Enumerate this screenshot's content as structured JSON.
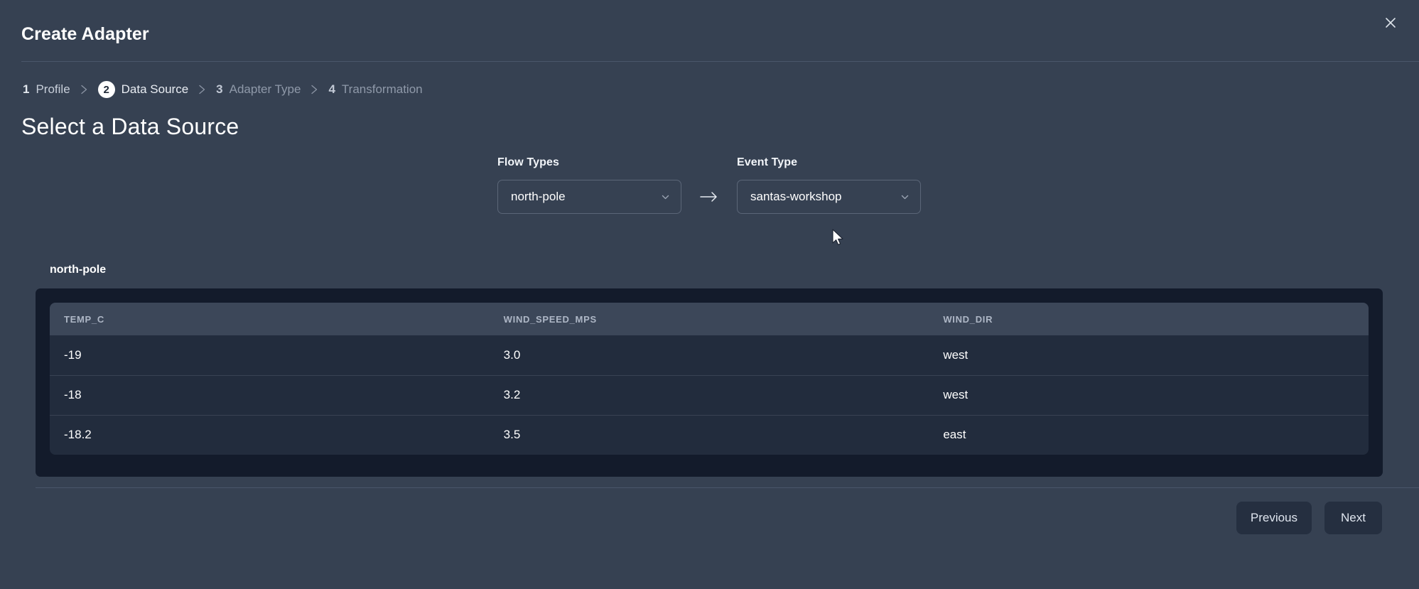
{
  "modal": {
    "title": "Create Adapter",
    "close_icon": "close-icon"
  },
  "stepper": {
    "separator_icon": "chevron-right-icon",
    "steps": [
      {
        "num": "1",
        "label": "Profile",
        "state": "done"
      },
      {
        "num": "2",
        "label": "Data Source",
        "state": "current"
      },
      {
        "num": "3",
        "label": "Adapter Type",
        "state": "future"
      },
      {
        "num": "4",
        "label": "Transformation",
        "state": "future"
      }
    ]
  },
  "page": {
    "heading": "Select a Data Source"
  },
  "selectors": {
    "flow": {
      "label": "Flow Types",
      "value": "north-pole",
      "chevron_icon": "chevron-down-icon"
    },
    "arrow_icon": "arrow-right-icon",
    "event": {
      "label": "Event Type",
      "value": "santas-workshop",
      "chevron_icon": "chevron-down-icon"
    }
  },
  "preview": {
    "label": "north-pole",
    "columns": [
      "TEMP_C",
      "WIND_SPEED_MPS",
      "WIND_DIR"
    ],
    "rows": [
      [
        "-19",
        "3.0",
        "west"
      ],
      [
        "-18",
        "3.2",
        "west"
      ],
      [
        "-18.2",
        "3.5",
        "east"
      ]
    ]
  },
  "footer": {
    "previous_label": "Previous",
    "next_label": "Next"
  },
  "colors": {
    "background": "#364152",
    "panel": "#131b2b",
    "table_row": "#222c3d",
    "table_header": "#3c4759",
    "accent_text": "#ffffff"
  }
}
